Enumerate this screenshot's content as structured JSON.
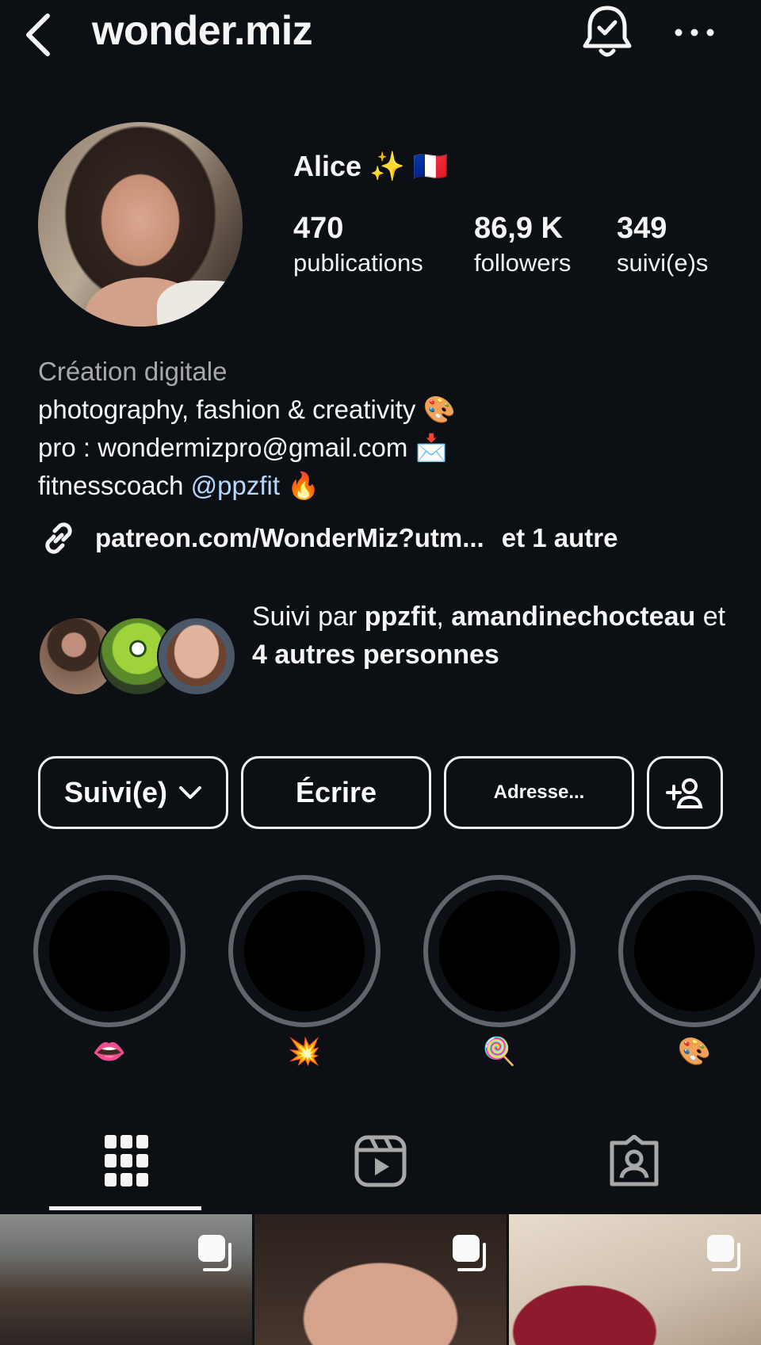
{
  "header": {
    "username": "wonder.miz",
    "back_icon": "chevron-left-icon",
    "bell_icon": "bell-check-icon",
    "more_icon": "more-horizontal-icon"
  },
  "profile": {
    "display_name": "Alice ✨ 🇫🇷",
    "stats": {
      "posts_count": "470",
      "posts_label": "publications",
      "followers_count": "86,9 K",
      "followers_label": "followers",
      "following_count": "349",
      "following_label": "suivi(e)s"
    }
  },
  "bio": {
    "category": "Création digitale",
    "line1": "photography, fashion & creativity 🎨",
    "line2": "pro : wondermizpro@gmail.com 📩",
    "line3_prefix": "fitnesscoach ",
    "line3_mention": "@ppzfit",
    "line3_suffix": " 🔥",
    "link_text": "patreon.com/WonderMiz?utm...",
    "link_extra": "et 1 autre"
  },
  "mutual": {
    "prefix": "Suivi par ",
    "user1": "ppzfit",
    "sep": ",",
    "user2": "amandinechocteau",
    "and": " et ",
    "others": "4 autres personnes"
  },
  "actions": {
    "following_label": "Suivi(e)",
    "message_label": "Écrire",
    "address_label": "Adresse..."
  },
  "highlights": [
    {
      "label": "👄"
    },
    {
      "label": "💥"
    },
    {
      "label": "🍭"
    },
    {
      "label": "🎨"
    }
  ],
  "tabs": [
    {
      "icon": "grid-icon",
      "active": true
    },
    {
      "icon": "reels-icon",
      "active": false
    },
    {
      "icon": "tagged-icon",
      "active": false
    }
  ],
  "colors": {
    "background": "#0c1014",
    "text": "#f5f5f5",
    "muted": "#a8a8a8",
    "mention": "#b7d7ff",
    "highlight_ring": "#61656b"
  }
}
